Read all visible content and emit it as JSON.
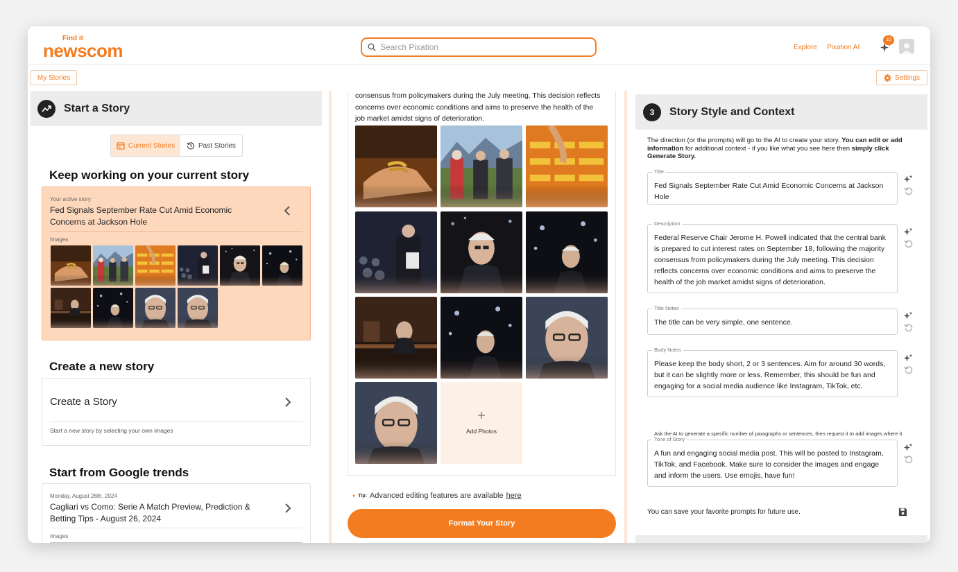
{
  "header": {
    "logo_find": "Find it",
    "logo_word": "newscom",
    "search_placeholder": "Search Pixation",
    "explore": "Explore",
    "pixation_ai": "Pixation AI",
    "notification_count": "10",
    "my_stories": "My Stories",
    "settings": "Settings"
  },
  "colors": {
    "accent": "#f47c20",
    "active_card_bg": "#fdd8bd",
    "panel_head_bg": "#ececec"
  },
  "left": {
    "panel_title": "Start a Story",
    "tabs": {
      "current": "Current Stories",
      "past": "Past Stories"
    },
    "keep_working_heading": "Keep working on your current story",
    "active_label": "Your active story",
    "active_title": "Fed Signals September Rate Cut Amid Economic Concerns at Jackson Hole",
    "images_label": "Images",
    "create_heading": "Create a new story",
    "create_title": "Create a Story",
    "create_sub": "Start a new story by selecting your own images",
    "trends_heading": "Start from Google trends",
    "trend_date": "Monday, August 26th, 2024",
    "trend_title": "Cagliari vs Como: Serie A Match Preview, Prediction & Betting Tips - August 26, 2024",
    "trend_images_label": "Images"
  },
  "middle": {
    "desc_top": "consensus from policymakers during the July meeting. This decision reflects concerns over economic conditions and aims to preserve the health of the job market amidst signs of deterioration.",
    "add_photos": "Add Photos",
    "tip_label": "Tip:",
    "tip_text": "Advanced editing features are available",
    "tip_link": "here",
    "format_button": "Format Your Story"
  },
  "right": {
    "step_number": "3",
    "panel_title": "Story Style and Context",
    "intro_a": "The direction (or the prompts) will go to the AI to create your story.",
    "intro_b": "You can edit or add information",
    "intro_c": "for additional context - if you like what you see here then",
    "intro_d": "simply click Generate Story.",
    "fields": [
      {
        "label": "Title",
        "value": "Fed Signals September Rate Cut Amid Economic Concerns at Jackson Hole"
      },
      {
        "label": "Description",
        "value": "Federal Reserve Chair Jerome H. Powell indicated that the central bank is prepared to cut interest rates on September 18, following the majority consensus from policymakers during the July meeting. This decision reflects concerns over economic conditions and aims to preserve the health of the job market amidst signs of deterioration."
      },
      {
        "label": "Title Notes",
        "value": "The title can be very simple, one sentence."
      },
      {
        "label": "Body Notes",
        "value": "Please keep the body short, 2 or 3 sentences. Aim for around 30 words, but it can be slightly more or less. Remember, this should be fun and engaging for a social media audience like Instagram, TikTok, etc."
      },
      {
        "label": "Tone of Story",
        "value": "A fun and engaging social media post. This will be posted to Instagram, TikTok, and Facebook. Make sure to consider the images and engage and inform the users. Use emojis, have fun!"
      }
    ],
    "hint": "Ask the AI to generate a specific number of paragraphs or sentences, then request it to add images where it deems most appropriate.",
    "save_text": "You can save your favorite prompts for future use."
  }
}
